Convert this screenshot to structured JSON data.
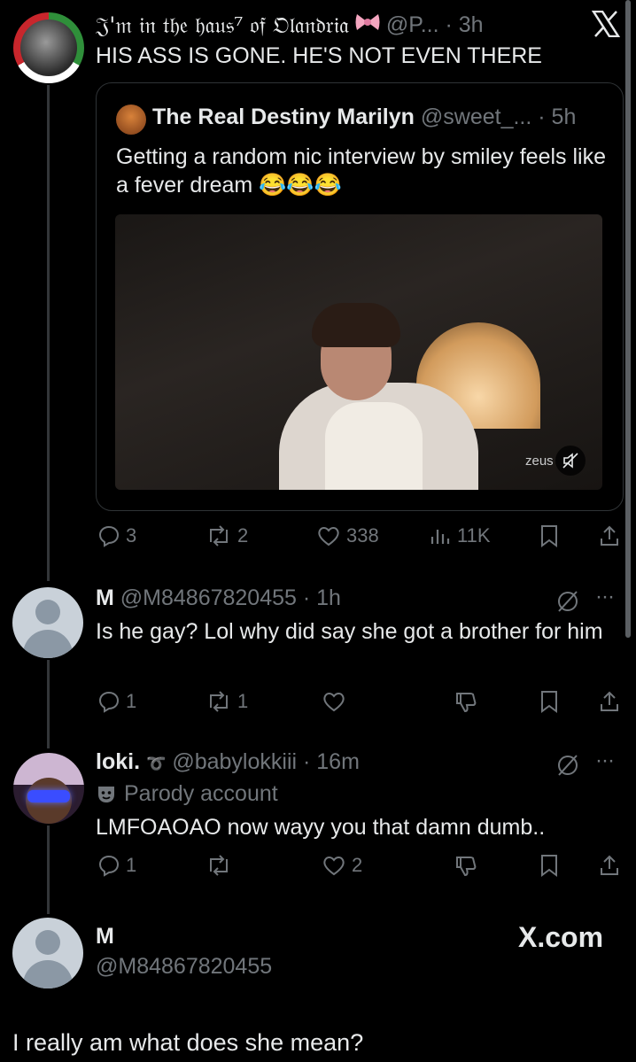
{
  "post1": {
    "display_name": "𝔍'𝔪 𝔦𝔫 𝔱𝔥𝔢 𝔥𝔞𝔲𝔰⁷ 𝔬𝔣 𝔒𝔩𝔞𝔫𝔡𝔯𝔦𝔞",
    "handle_time": "@P... · 3h",
    "text": "HIS ASS IS GONE. HE'S NOT EVEN THERE",
    "quote": {
      "name": "The Real Destiny Marilyn",
      "handle_time": "@sweet_... · 5h",
      "text": "Getting a random nic interview by smiley feels like a fever dream 😂😂😂",
      "video_watermark": "zeus"
    },
    "actions": {
      "replies": "3",
      "reposts": "2",
      "likes": "338",
      "views": "11K"
    }
  },
  "reply1": {
    "name": "M",
    "handle_time": "@M84867820455 · 1h",
    "text": "Is he gay? Lol why did say she got a brother for him",
    "actions": {
      "replies": "1",
      "reposts": "1"
    }
  },
  "reply2": {
    "name": "loki.",
    "name_symbol": "➰",
    "handle_time": "@babylokkiii · 16m",
    "parody_label": "Parody account",
    "text": "LMFOAOAO now wayy you that damn dumb..",
    "actions": {
      "replies": "1",
      "likes": "2"
    }
  },
  "reply3": {
    "name": "M",
    "handle": "@M84867820455",
    "text": "I really am what does she mean?",
    "brand": "X.com"
  },
  "colors": {
    "background": "#000000",
    "text": "#e7e9ea",
    "muted": "#71767b",
    "border": "#2f3336"
  }
}
